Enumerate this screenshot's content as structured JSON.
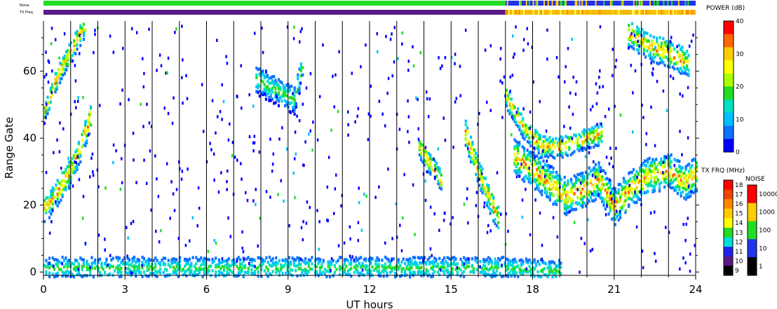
{
  "chart_data": {
    "type": "heatmap",
    "title": "",
    "xlabel": "UT hours",
    "ylabel": "Range Gate",
    "xlim": [
      0,
      24
    ],
    "ylim": [
      -1,
      75
    ],
    "x_ticks": [
      0,
      3,
      6,
      9,
      12,
      15,
      18,
      21,
      24
    ],
    "y_ticks": [
      0,
      20,
      40,
      60
    ],
    "hour_lines": [
      1,
      2,
      3,
      4,
      5,
      6,
      7,
      8,
      9,
      10,
      11,
      12,
      13,
      14,
      15,
      16,
      17,
      18,
      19,
      20,
      21,
      22,
      23
    ],
    "status_bars": {
      "noise_label": "Noise",
      "txfreq_label": "TX Freq",
      "noise_segments": [
        {
          "start": 0,
          "end": 17,
          "color": "#22dd22"
        },
        {
          "start": 17,
          "end": 24,
          "color": "#2233ee",
          "mixed": true
        }
      ],
      "txfreq_segments": [
        {
          "start": 0,
          "end": 17,
          "color": "#5a1a8a"
        },
        {
          "start": 17,
          "end": 24,
          "color": "#f5b800",
          "mixed": true
        }
      ]
    },
    "power_colorbar": {
      "title": "POWER (dB)",
      "ticks": [
        "40",
        "30",
        "20",
        "10",
        "0"
      ],
      "colors": [
        "#ff0000",
        "#ff6600",
        "#ffcc00",
        "#ffff00",
        "#aaff00",
        "#22dd22",
        "#00e0c0",
        "#00c0ff",
        "#1070ff",
        "#0000ff"
      ]
    },
    "txfreq_colorbar": {
      "title": "TX FRQ (MHz)",
      "ticks": [
        "18",
        "17",
        "16",
        "15",
        "14",
        "13",
        "12",
        "11",
        "10",
        "9"
      ],
      "colors": [
        "#ff0000",
        "#ee4400",
        "#ff8800",
        "#ffcc00",
        "#ffff00",
        "#22dd22",
        "#00dddd",
        "#2222ee",
        "#5a1a8a",
        "#000000"
      ]
    },
    "noise_colorbar": {
      "title": "NOISE",
      "ticks": [
        "10000",
        "1000",
        "100",
        "10",
        "1"
      ],
      "colors": [
        "#ff0000",
        "#ffcc00",
        "#22dd22",
        "#2233ee",
        "#000000"
      ]
    },
    "echo_regions": [
      {
        "name": "morning-band",
        "points": [
          [
            0.0,
            20
          ],
          [
            0.3,
            22
          ],
          [
            0.6,
            26
          ],
          [
            0.9,
            30
          ],
          [
            1.2,
            35
          ],
          [
            1.5,
            42
          ],
          [
            1.7,
            47
          ]
        ],
        "halfwidth": 4
      },
      {
        "name": "afternoon-band",
        "points": [
          [
            15.5,
            42
          ],
          [
            16.0,
            30
          ],
          [
            16.4,
            22
          ],
          [
            16.7,
            17
          ]
        ],
        "halfwidth": 4
      },
      {
        "name": "evening-band",
        "points": [
          [
            17.3,
            35
          ],
          [
            18.0,
            31
          ],
          [
            18.6,
            27
          ],
          [
            19.2,
            23
          ],
          [
            19.8,
            25
          ],
          [
            20.4,
            28
          ],
          [
            21.0,
            20
          ],
          [
            21.5,
            25
          ],
          [
            22.2,
            29
          ],
          [
            23.0,
            31
          ],
          [
            23.6,
            27
          ],
          [
            24.0,
            30
          ]
        ],
        "halfwidth": 5
      },
      {
        "name": "evening-upper",
        "points": [
          [
            17.0,
            53
          ],
          [
            17.6,
            44
          ],
          [
            18.3,
            38
          ],
          [
            19.0,
            38
          ],
          [
            19.8,
            40
          ],
          [
            20.5,
            42
          ]
        ],
        "halfwidth": 3
      },
      {
        "name": "late-upper",
        "points": [
          [
            21.5,
            72
          ],
          [
            22.3,
            68
          ],
          [
            23.0,
            66
          ],
          [
            23.7,
            63
          ]
        ],
        "halfwidth": 4
      },
      {
        "name": "morning-upper",
        "points": [
          [
            0.0,
            48
          ],
          [
            0.4,
            57
          ],
          [
            0.8,
            64
          ],
          [
            1.2,
            70
          ],
          [
            1.5,
            74
          ]
        ],
        "halfwidth": 3
      },
      {
        "name": "afternoon-mid",
        "points": [
          [
            13.8,
            38
          ],
          [
            14.2,
            33
          ],
          [
            14.6,
            28
          ]
        ],
        "halfwidth": 3
      },
      {
        "name": "scatter-patch",
        "points": [
          [
            7.8,
            58
          ],
          [
            8.5,
            55
          ],
          [
            9.2,
            52
          ],
          [
            9.5,
            62
          ]
        ],
        "halfwidth": 4
      },
      {
        "name": "ground-scatter",
        "points": [
          [
            0,
            2
          ],
          [
            6,
            2
          ],
          [
            12,
            2
          ],
          [
            17,
            2
          ],
          [
            19,
            1
          ]
        ],
        "halfwidth": 3
      }
    ]
  }
}
